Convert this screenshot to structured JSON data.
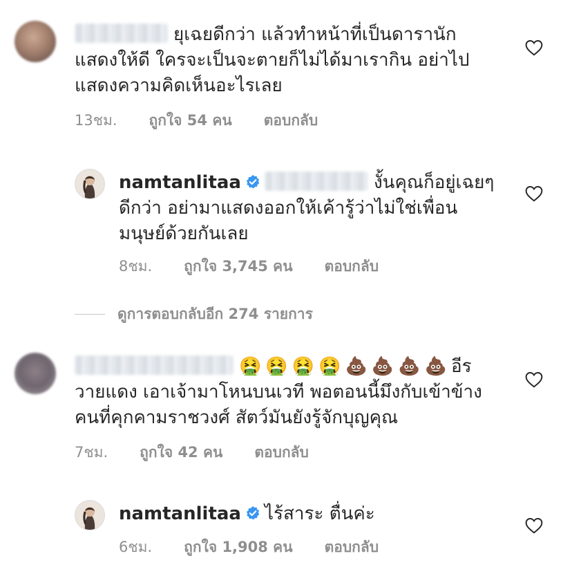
{
  "comments": [
    {
      "text_lines": [
        "ยุเฉยดีกว่า แล้วทำหน้าที่เป็นดารานัก",
        "แสดงให้ดี ใครจะเป็นจะตายก็ไม่ได้มาเรากิน อย่าไป",
        "แสดงความคิดเห็นอะไรเลย"
      ],
      "time": "13ชม.",
      "likes": "ถูกใจ 54 คน",
      "reply": "ตอบกลับ"
    },
    {
      "username": "namtanlitaa",
      "text_lines": [
        "งั้นคุณก็อยู่เฉยๆ",
        "ดีกว่า อย่ามาแสดงออกให้เค้ารู้ว่าไม่ใช่เพื่อน",
        "มนุษย์ด้วยกันเลย"
      ],
      "time": "8ชม.",
      "likes": "ถูกใจ 3,745 คน",
      "reply": "ตอบกลับ"
    },
    {
      "emojis": [
        "🤮",
        "🤮",
        "🤮",
        "🤮",
        "💩",
        "💩",
        "💩",
        "💩"
      ],
      "text_lines": [
        "อีร",
        "วายแดง เอาเจ้ามาโหนบนเวที พอตอนนี้มึงกับเข้าข้าง",
        "คนที่คุกคามราชวงศ์ สัตว์มันยังรู้จักบุญคุณ"
      ],
      "time": "7ชม.",
      "likes": "ถูกใจ 42 คน",
      "reply": "ตอบกลับ"
    },
    {
      "username": "namtanlitaa",
      "text_lines": [
        "ไร้สาระ ตื่นค่ะ"
      ],
      "time": "6ชม.",
      "likes": "ถูกใจ 1,908 คน",
      "reply": "ตอบกลับ"
    }
  ],
  "view_replies": "ดูการตอบกลับอีก 274 รายการ",
  "colors": {
    "text": "#262626",
    "secondary": "#8e8e8e",
    "verified": "#3897f0"
  }
}
